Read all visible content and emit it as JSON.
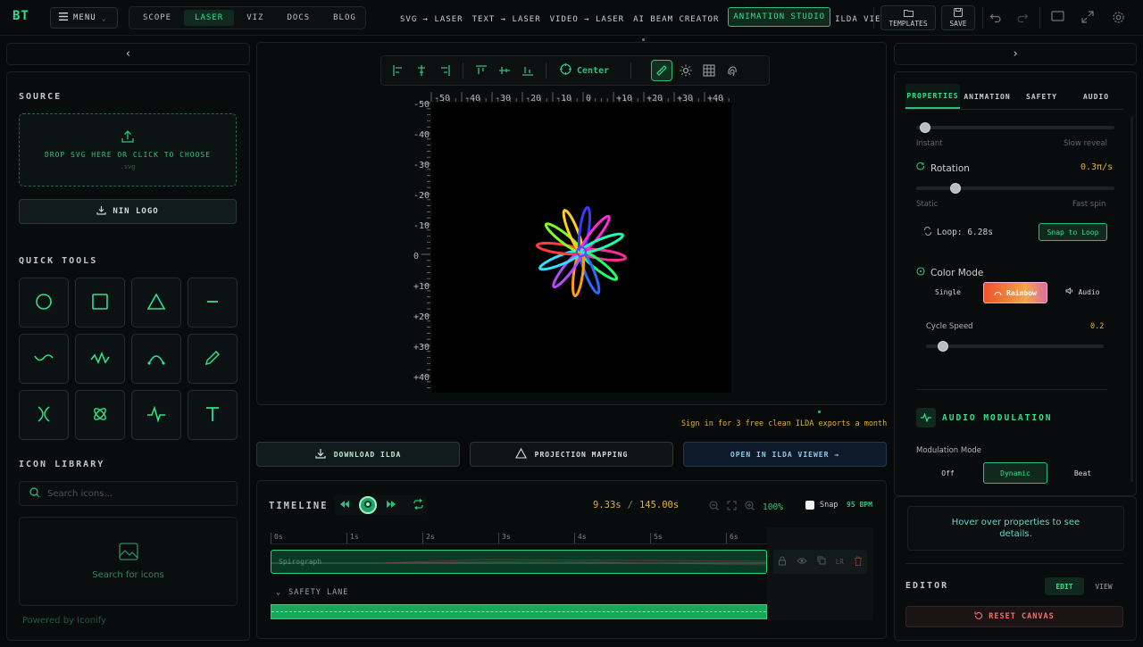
{
  "topbar": {
    "logo": "BT",
    "menu_label": "MENU",
    "tabs": [
      "SCOPE",
      "LASER",
      "VIZ",
      "DOCS",
      "BLOG"
    ],
    "active_tab": "LASER",
    "nav": [
      "SVG → LASER",
      "TEXT → LASER",
      "VIDEO → LASER",
      "AI BEAM CREATOR",
      "ANIMATION STUDIO",
      "ILDA VIEWER"
    ],
    "active_nav": "ANIMATION STUDIO",
    "templates_label": "TEMPLATES",
    "save_label": "SAVE"
  },
  "left": {
    "collapse_arrow": "‹",
    "source_title": "SOURCE",
    "drop_text": "DROP SVG HERE OR CLICK TO CHOOSE",
    "drop_sub": ".svg",
    "nin_label": "NIN LOGO",
    "quick_tools_title": "QUICK TOOLS",
    "tools": [
      "circle-tool",
      "square-tool",
      "triangle-tool",
      "line-tool",
      "wave-tool",
      "zigzag-tool",
      "arc-tool",
      "pen-tool",
      "lissajous-tool",
      "flower-tool",
      "pulse-tool",
      "text-tool"
    ],
    "icon_library_title": "ICON LIBRARY",
    "search_placeholder": "Search icons...",
    "search_results_text": "Search for icons",
    "powered_by": "Powered by Iconify"
  },
  "canvas": {
    "toolbar_center_label": "Center",
    "x_ticks": [
      "-50",
      "-40",
      "-30",
      "-20",
      "-10",
      "0",
      "+10",
      "+20",
      "+30",
      "+40"
    ],
    "y_ticks": [
      "-50",
      "-40",
      "-30",
      "-20",
      "-10",
      "0",
      "+10",
      "+20",
      "+30",
      "+40"
    ],
    "sign_in_note": "Sign in for 3 free clean ILDA exports a month"
  },
  "actions": {
    "download": "DOWNLOAD ILDA",
    "projection": "PROJECTION MAPPING",
    "open_viewer": "OPEN IN ILDA VIEWER →"
  },
  "timeline": {
    "title": "TIMELINE",
    "time_current": "9.33s",
    "time_separator": "/",
    "time_total": "145.00s",
    "zoom": "100%",
    "snap_label": "Snap",
    "bpm": "95 BPM",
    "ruler": [
      "0s",
      "1s",
      "2s",
      "3s",
      "4s",
      "5s",
      "6s"
    ],
    "clip_label": "Spirograph",
    "lane_label": "SAFETY LANE",
    "clip_tools": [
      "lock-icon",
      "eye-icon",
      "copy-icon",
      "LR",
      "trash-icon"
    ],
    "clip_tool_lr": "LR"
  },
  "right": {
    "collapse_arrow": "›",
    "tabs": [
      "PROPERTIES",
      "ANIMATION",
      "SAFETY",
      "AUDIO"
    ],
    "active_tab": "PROPERTIES",
    "reveal_min": "Instant",
    "reveal_max": "Slow reveal",
    "reveal_level": 0.02,
    "rotation_label": "Rotation",
    "rotation_value": "0.3π/s",
    "rotation_min": "Static",
    "rotation_max": "Fast spin",
    "rotation_level": 0.18,
    "loop_label": "Loop: 6.28s",
    "snap_loop_label": "Snap to Loop",
    "color_mode_label": "Color Mode",
    "color_modes": [
      "Single",
      "Rainbow",
      "Audio"
    ],
    "active_color_mode": "Rainbow",
    "cycle_speed_label": "Cycle Speed",
    "cycle_speed_value": "0.2",
    "cycle_speed_level": 0.07,
    "audio_mod_title": "AUDIO MODULATION",
    "mod_mode_label": "Modulation Mode",
    "mod_modes": [
      "Off",
      "Dynamic",
      "Beat"
    ],
    "active_mod_mode": "Dynamic",
    "hover_hint": "Hover over properties to see details.",
    "editor_title": "EDITOR",
    "editor_modes": [
      "EDIT",
      "VIEW"
    ],
    "active_editor_mode": "EDIT",
    "reset_label": "RESET CANVAS"
  },
  "colors": {
    "accent": "#33e08a",
    "background": "#07090a",
    "danger": "#ff5a5a",
    "warn": "#e0b23a"
  }
}
